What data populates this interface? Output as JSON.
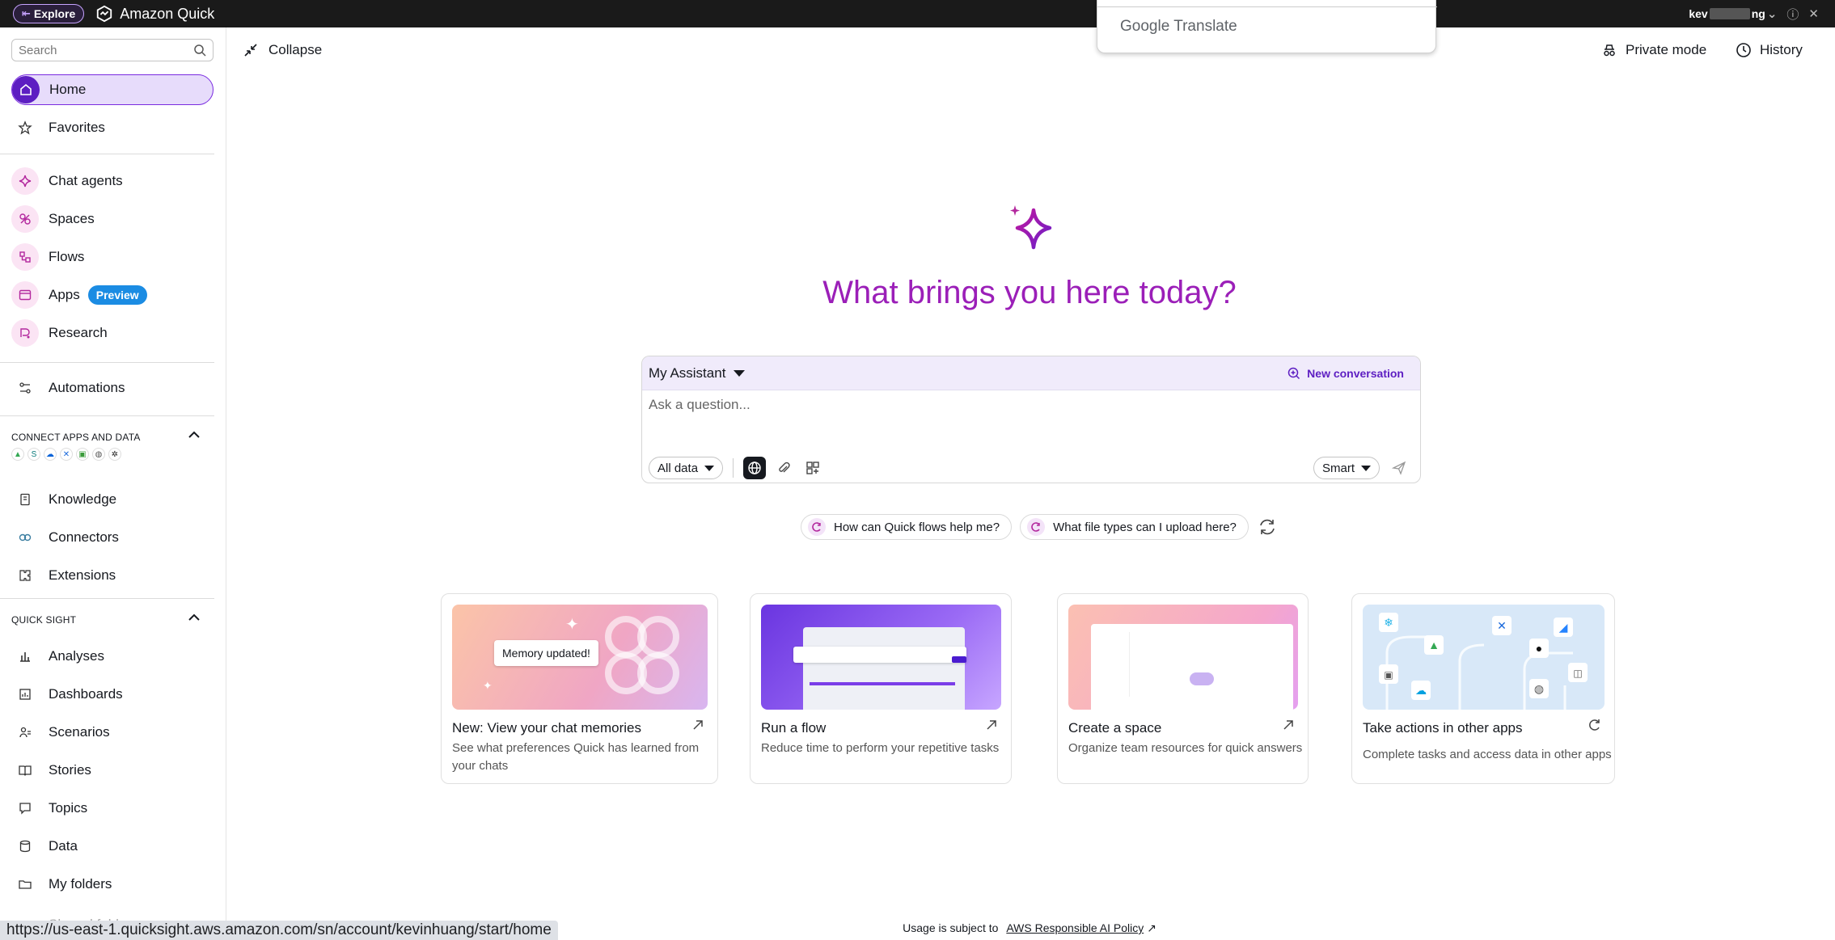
{
  "topbar": {
    "explore_label": "Explore",
    "brand": "Amazon Quick",
    "user_prefix": "kev",
    "user_suffix": "ng"
  },
  "translate_popup": {
    "label": "Google Translate"
  },
  "sidebar": {
    "search_placeholder": "Search",
    "home": "Home",
    "favorites": "Favorites",
    "chat_agents": "Chat agents",
    "spaces": "Spaces",
    "flows": "Flows",
    "apps": "Apps",
    "apps_badge": "Preview",
    "research": "Research",
    "automations": "Automations",
    "connect_section": "CONNECT APPS AND DATA",
    "knowledge": "Knowledge",
    "connectors": "Connectors",
    "extensions": "Extensions",
    "quicksight_section": "QUICK SIGHT",
    "analyses": "Analyses",
    "dashboards": "Dashboards",
    "scenarios": "Scenarios",
    "stories": "Stories",
    "topics": "Topics",
    "data": "Data",
    "my_folders": "My folders",
    "shared_folders": "Shared folders"
  },
  "status_url": "https://us-east-1.quicksight.aws.amazon.com/sn/account/kevinhuang/start/home",
  "header": {
    "collapse": "Collapse",
    "private_mode": "Private mode",
    "history": "History"
  },
  "hero": {
    "headline": "What brings you here today?"
  },
  "chat": {
    "assistant": "My Assistant",
    "new_conversation": "New conversation",
    "input_placeholder": "Ask a question...",
    "data_scope": "All data",
    "mode": "Smart"
  },
  "suggestions": [
    "How can Quick flows help me?",
    "What file types can I upload here?"
  ],
  "cards": [
    {
      "title": "New: View your chat memories",
      "desc_line1": "See what preferences Quick has learned from",
      "desc_line2": "your chats",
      "thumb_label": "Memory updated!"
    },
    {
      "title": "Run a flow",
      "desc_line1": "Reduce time to perform your repetitive tasks",
      "desc_line2": ""
    },
    {
      "title": "Create a space",
      "desc_line1": "Organize team resources for quick answers",
      "desc_line2": ""
    },
    {
      "title": "Take actions in other apps",
      "desc_line1": "Complete tasks and access data in other apps",
      "desc_line2": ""
    }
  ],
  "footer": {
    "text": "Usage is subject to",
    "link": "AWS Responsible AI Policy"
  },
  "colors": {
    "accent": "#5d1ec2",
    "headline": "#9b1fb8",
    "badge": "#1b8ce3"
  }
}
